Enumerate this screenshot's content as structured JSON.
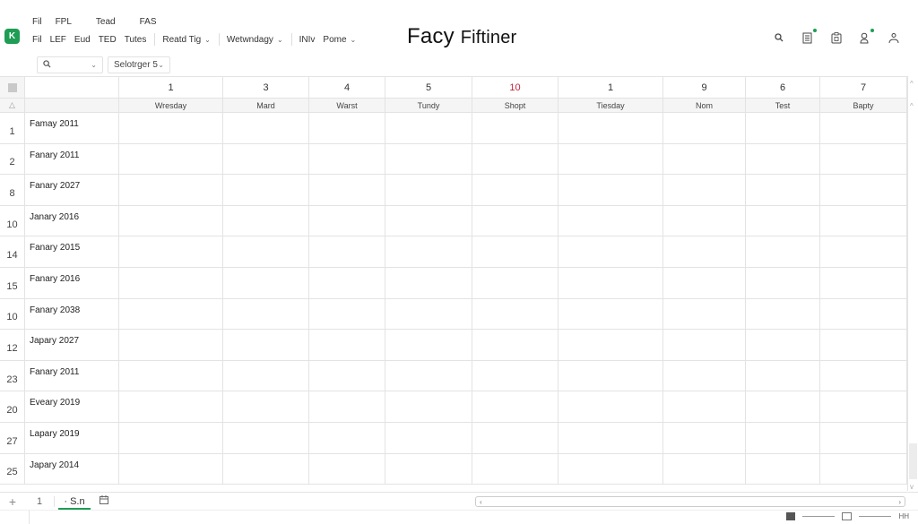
{
  "app": {
    "icon_letter": "K",
    "title_main": "Facy",
    "title_sub": "Fiftiner"
  },
  "menu": {
    "top": [
      "Fil",
      "FPL",
      "Tead",
      "FAS"
    ],
    "row": [
      "Fil",
      "LEF",
      "Eud",
      "TED",
      "Tutes"
    ],
    "dropdowns": [
      "Reatd Tig",
      "Wetwndagy"
    ],
    "extra": [
      "INIv"
    ],
    "last_dropdown": "Pome"
  },
  "top_icons": [
    "search-icon",
    "list-icon",
    "clipboard-icon",
    "user-notify-icon",
    "account-icon"
  ],
  "toolbar": {
    "search_placeholder": "",
    "sheet_selector": "Selotrger 5"
  },
  "columns": {
    "numbers": [
      "1",
      "3",
      "4",
      "5",
      "10",
      "1",
      "9",
      "6",
      "7"
    ],
    "highlighted_index": 4,
    "names": [
      "Wresday",
      "Mard",
      "Warst",
      "Tundy",
      "Shopt",
      "Tiesday",
      "Nom",
      "Test",
      "Bapty"
    ]
  },
  "rows": [
    {
      "num": "1",
      "label": "Famay 2011"
    },
    {
      "num": "2",
      "label": "Fanary 2011"
    },
    {
      "num": "8",
      "label": "Fanary 2027"
    },
    {
      "num": "10",
      "label": "Janary 2016"
    },
    {
      "num": "14",
      "label": "Fanary 2015"
    },
    {
      "num": "15",
      "label": "Fanary 2016"
    },
    {
      "num": "10",
      "label": "Fanary 2038"
    },
    {
      "num": "12",
      "label": "Japary 2027"
    },
    {
      "num": "23",
      "label": "Fanary 2011"
    },
    {
      "num": "20",
      "label": "Eveary 2019"
    },
    {
      "num": "27",
      "label": "Lapary 2019"
    },
    {
      "num": "25",
      "label": "Japary 2014"
    }
  ],
  "sheet_tabs": {
    "add": "+",
    "tab1": "1",
    "tab2": "· S.n"
  },
  "status": {
    "zoom_label": "HH"
  },
  "colors": {
    "accent": "#1f9d55",
    "highlight_red": "#c5223b"
  }
}
